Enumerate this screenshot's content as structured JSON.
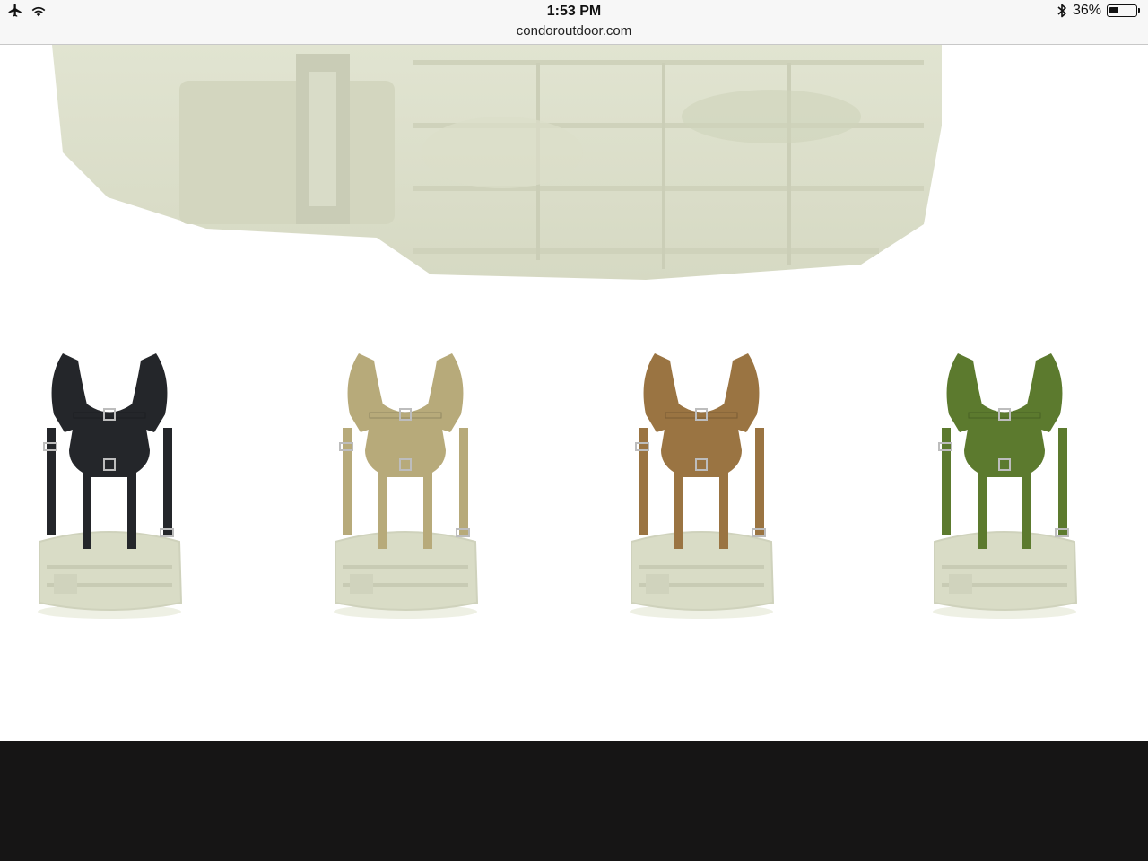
{
  "status_bar": {
    "time": "1:53 PM",
    "url": "condoroutdoor.com",
    "battery_text": "36%",
    "battery_level": 0.36,
    "icons": [
      "airplane-icon",
      "wifi-icon",
      "bluetooth-icon",
      "battery-icon"
    ]
  },
  "hero": {
    "image": "belt-image"
  },
  "variants": [
    {
      "name": "black",
      "color": "#24262a"
    },
    {
      "name": "tan",
      "color": "#b7aa7a"
    },
    {
      "name": "coyote",
      "color": "#9a7442"
    },
    {
      "name": "olive",
      "color": "#5c7a2e"
    }
  ],
  "colors": {
    "belt": "#d9dcc6",
    "footer": "#161515",
    "topbar": "#f7f7f7"
  }
}
